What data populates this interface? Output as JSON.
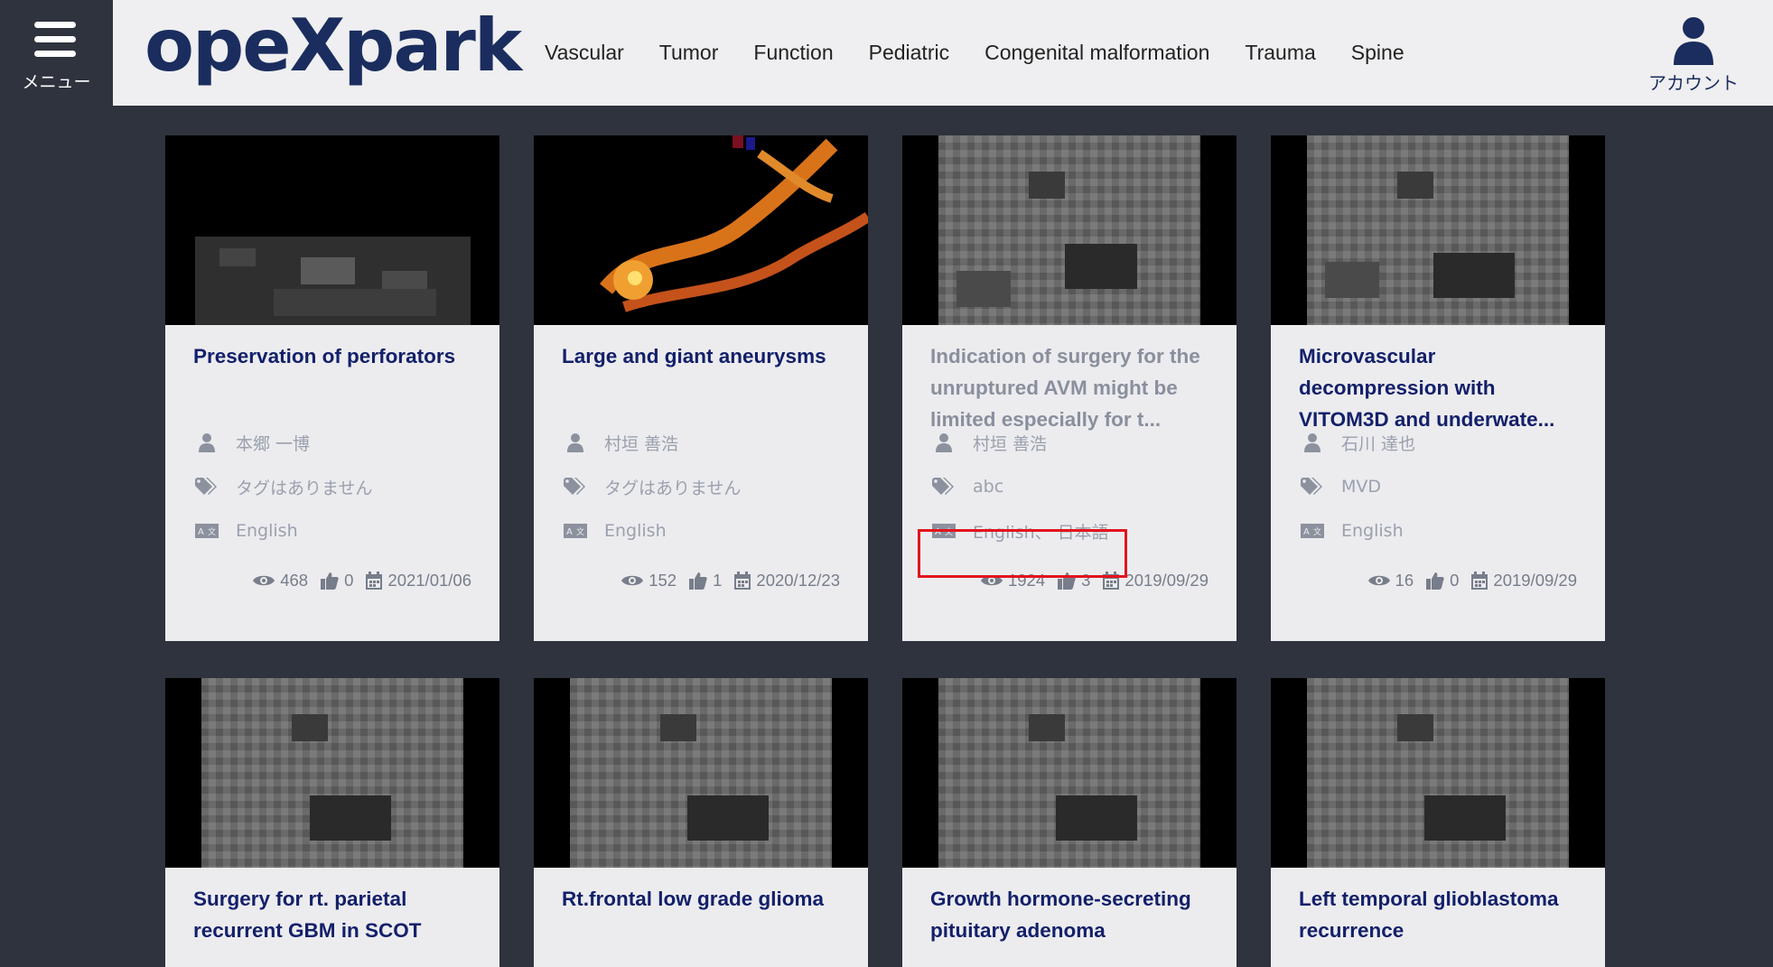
{
  "header": {
    "menu_label": "メニュー",
    "logo": "opeXpark",
    "nav": [
      "Vascular",
      "Tumor",
      "Function",
      "Pediatric",
      "Congenital malformation",
      "Trauma",
      "Spine"
    ],
    "account_label": "アカウント"
  },
  "colors": {
    "header_bg": "#efeff1",
    "page_bg": "#2e333d",
    "brand": "#1a2d5e",
    "title": "#13206a",
    "highlight": "#e3141d"
  },
  "cards": [
    {
      "title": "Preservation of perforators",
      "author": "本郷 一博",
      "tags": "タグはありません",
      "language": "English",
      "views": "468",
      "likes": "0",
      "date": "2021/01/06"
    },
    {
      "title": "Large and giant aneurysms",
      "author": "村垣 善浩",
      "tags": "タグはありません",
      "language": "English",
      "views": "152",
      "likes": "1",
      "date": "2020/12/23"
    },
    {
      "title": "Indication of surgery for the unruptured AVM might be limited especially for t...",
      "author": "村垣 善浩",
      "tags": "abc",
      "language": "English、 日本語",
      "views": "1924",
      "likes": "3",
      "date": "2019/09/29"
    },
    {
      "title": "Microvascular decompression with VITOM3D and underwate...",
      "author": "石川 達也",
      "tags": "MVD",
      "language": "English",
      "views": "16",
      "likes": "0",
      "date": "2019/09/29"
    },
    {
      "title": "Surgery for rt. parietal recurrent GBM in SCOT"
    },
    {
      "title": "Rt.frontal low grade glioma"
    },
    {
      "title": "Growth hormone-secreting pituitary adenoma"
    },
    {
      "title": "Left temporal glioblastoma recurrence"
    }
  ]
}
